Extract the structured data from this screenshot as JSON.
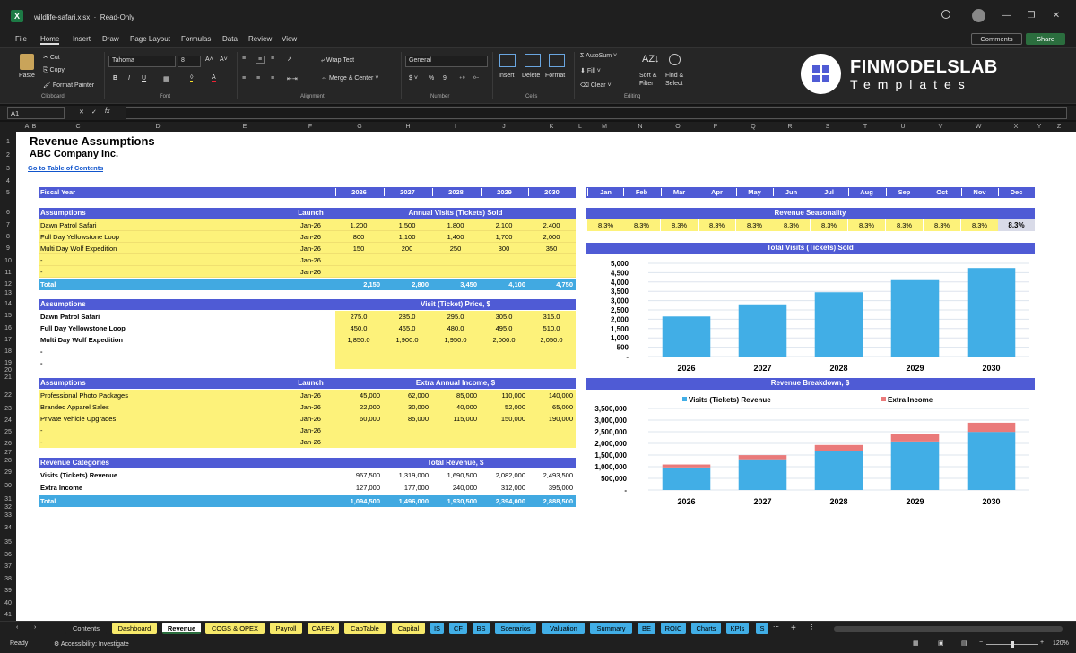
{
  "window": {
    "title": "wildlife-safari.xlsx",
    "mode": "Read-Only"
  },
  "menu": [
    "File",
    "Home",
    "Insert",
    "Draw",
    "Page Layout",
    "Formulas",
    "Data",
    "Review",
    "View"
  ],
  "menu_active": "Home",
  "comments_label": "Comments",
  "share_label": "Share",
  "ribbon": {
    "clipboard": {
      "paste": "Paste",
      "cut": "Cut",
      "copy": "Copy",
      "format_painter": "Format Painter",
      "group": "Clipboard"
    },
    "font": {
      "name": "Tahoma",
      "size": "8",
      "group": "Font",
      "bold": "B",
      "italic": "I",
      "underline": "U"
    },
    "alignment": {
      "wrap": "Wrap Text",
      "merge": "Merge & Center",
      "group": "Alignment"
    },
    "number": {
      "format": "General",
      "group": "Number",
      "currency": "$",
      "percent": "%",
      "comma": "9"
    },
    "cells": {
      "insert": "Insert",
      "delete": "Delete",
      "format": "Format",
      "group": "Cells"
    },
    "editing": {
      "autosum": "AutoSum",
      "fill": "Fill",
      "clear": "Clear",
      "sort": "Sort &\nFilter",
      "find": "Find &\nSelect",
      "group": "Editing"
    }
  },
  "brand": {
    "name": "FINMODELSLAB",
    "sub": "Templates"
  },
  "formula": {
    "namebox": "A1",
    "fx": "fx"
  },
  "columns": [
    "A",
    "B",
    "C",
    "D",
    "E",
    "F",
    "G",
    "H",
    "I",
    "J",
    "K",
    "L",
    "M",
    "N",
    "O",
    "P",
    "Q",
    "R",
    "S",
    "T",
    "U",
    "V",
    "W",
    "X",
    "Y",
    "Z"
  ],
  "sheet": {
    "title": "Revenue Assumptions",
    "company": "ABC Company Inc.",
    "toc_link": "Go to Table of Contents",
    "fiscal_year_label": "Fiscal Year",
    "years": [
      "2026",
      "2027",
      "2028",
      "2029",
      "2030"
    ],
    "months": [
      "Jan",
      "Feb",
      "Mar",
      "Apr",
      "May",
      "Jun",
      "Jul",
      "Aug",
      "Sep",
      "Oct",
      "Nov",
      "Dec"
    ],
    "assumptions_label": "Assumptions",
    "launch_label": "Launch",
    "visits": {
      "header": "Annual Visits (Tickets) Sold",
      "rows": [
        {
          "name": "Dawn Patrol Safari",
          "launch": "Jan-26",
          "values": [
            "1,200",
            "1,500",
            "1,800",
            "2,100",
            "2,400"
          ]
        },
        {
          "name": "Full Day Yellowstone Loop",
          "launch": "Jan-26",
          "values": [
            "800",
            "1,100",
            "1,400",
            "1,700",
            "2,000"
          ]
        },
        {
          "name": "Multi Day Wolf Expedition",
          "launch": "Jan-26",
          "values": [
            "150",
            "200",
            "250",
            "300",
            "350"
          ]
        },
        {
          "name": "-",
          "launch": "Jan-26",
          "values": [
            "",
            "",
            "",
            "",
            ""
          ]
        },
        {
          "name": "-",
          "launch": "Jan-26",
          "values": [
            "",
            "",
            "",
            "",
            ""
          ]
        }
      ],
      "total_label": "Total",
      "totals": [
        "2,150",
        "2,800",
        "3,450",
        "4,100",
        "4,750"
      ]
    },
    "price": {
      "header": "Visit (Ticket) Price, $",
      "rows": [
        {
          "name": "Dawn Patrol Safari",
          "values": [
            "275.0",
            "285.0",
            "295.0",
            "305.0",
            "315.0"
          ]
        },
        {
          "name": "Full Day Yellowstone Loop",
          "values": [
            "450.0",
            "465.0",
            "480.0",
            "495.0",
            "510.0"
          ]
        },
        {
          "name": "Multi Day Wolf Expedition",
          "values": [
            "1,850.0",
            "1,900.0",
            "1,950.0",
            "2,000.0",
            "2,050.0"
          ]
        },
        {
          "name": "-",
          "values": [
            "",
            "",
            "",
            "",
            ""
          ]
        },
        {
          "name": "-",
          "values": [
            "",
            "",
            "",
            "",
            ""
          ]
        }
      ]
    },
    "extra": {
      "header": "Extra Annual Income, $",
      "rows": [
        {
          "name": "Professional Photo Packages",
          "launch": "Jan-26",
          "values": [
            "45,000",
            "62,000",
            "85,000",
            "110,000",
            "140,000"
          ]
        },
        {
          "name": "Branded Apparel Sales",
          "launch": "Jan-26",
          "values": [
            "22,000",
            "30,000",
            "40,000",
            "52,000",
            "65,000"
          ]
        },
        {
          "name": "Private Vehicle Upgrades",
          "launch": "Jan-26",
          "values": [
            "60,000",
            "85,000",
            "115,000",
            "150,000",
            "190,000"
          ]
        },
        {
          "name": "-",
          "launch": "Jan-26",
          "values": [
            "",
            "",
            "",
            "",
            ""
          ]
        },
        {
          "name": "-",
          "launch": "Jan-26",
          "values": [
            "",
            "",
            "",
            "",
            ""
          ]
        }
      ]
    },
    "revenue": {
      "label": "Revenue Categories",
      "header": "Total Revenue, $",
      "rows": [
        {
          "name": "Visits (Tickets) Revenue",
          "values": [
            "967,500",
            "1,319,000",
            "1,690,500",
            "2,082,000",
            "2,493,500"
          ]
        },
        {
          "name": "Extra Income",
          "values": [
            "127,000",
            "177,000",
            "240,000",
            "312,000",
            "395,000"
          ]
        }
      ],
      "total_label": "Total",
      "totals": [
        "1,094,500",
        "1,496,000",
        "1,930,500",
        "2,394,000",
        "2,888,500"
      ]
    },
    "seasonality": {
      "header": "Revenue Seasonality",
      "values": [
        "8.3%",
        "8.3%",
        "8.3%",
        "8.3%",
        "8.3%",
        "8.3%",
        "8.3%",
        "8.3%",
        "8.3%",
        "8.3%",
        "8.3%",
        "8.3%"
      ]
    }
  },
  "row_numbers": [
    "1",
    "2",
    "3",
    "4",
    "5",
    "6",
    "7",
    "8",
    "9",
    "10",
    "11",
    "12",
    "13",
    "14",
    "15",
    "16",
    "17",
    "18",
    "19",
    "20",
    "21",
    "22",
    "23",
    "24",
    "25",
    "26",
    "27",
    "28",
    "29",
    "30",
    "31",
    "32",
    "33",
    "34",
    "35",
    "36",
    "37",
    "38",
    "39",
    "40",
    "41",
    "42"
  ],
  "chart_data": [
    {
      "type": "bar",
      "title": "Total Visits (Tickets) Sold",
      "categories": [
        "2026",
        "2027",
        "2028",
        "2029",
        "2030"
      ],
      "values": [
        2150,
        2800,
        3450,
        4100,
        4750
      ],
      "yticks": [
        "5,000",
        "4,500",
        "4,000",
        "3,500",
        "3,000",
        "2,500",
        "2,000",
        "1,500",
        "1,000",
        "500",
        "-"
      ],
      "ylim": [
        0,
        5000
      ],
      "color": "#41aee6",
      "grid": true
    },
    {
      "type": "bar",
      "title": "Revenue Breakdown, $",
      "categories": [
        "2026",
        "2027",
        "2028",
        "2029",
        "2030"
      ],
      "series": [
        {
          "name": "Visits (Tickets) Revenue",
          "values": [
            967500,
            1319000,
            1690500,
            2082000,
            2493500
          ],
          "color": "#41aee6"
        },
        {
          "name": "Extra Income",
          "values": [
            127000,
            177000,
            240000,
            312000,
            395000
          ],
          "color": "#ea7a7a"
        }
      ],
      "yticks": [
        "3,500,000",
        "3,000,000",
        "2,500,000",
        "2,000,000",
        "1,500,000",
        "1,000,000",
        "500,000",
        "-"
      ],
      "ylim": [
        0,
        3500000
      ],
      "stacked": true,
      "legend": "top",
      "grid": true
    }
  ],
  "tabs": [
    {
      "label": "Contents",
      "color": "#1f1f1f",
      "text": "#ddd"
    },
    {
      "label": "Dashboard",
      "color": "#f7e96a",
      "text": "#000"
    },
    {
      "label": "Revenue",
      "color": "#ffffff",
      "text": "#000",
      "active": true
    },
    {
      "label": "COGS & OPEX",
      "color": "#f7e96a",
      "text": "#000"
    },
    {
      "label": "Payroll",
      "color": "#f7e96a",
      "text": "#000"
    },
    {
      "label": "CAPEX",
      "color": "#f7e96a",
      "text": "#000"
    },
    {
      "label": "CapTable",
      "color": "#f7e96a",
      "text": "#000"
    },
    {
      "label": "Capital",
      "color": "#f7e96a",
      "text": "#000"
    },
    {
      "label": "IS",
      "color": "#41aee6",
      "text": "#000"
    },
    {
      "label": "CF",
      "color": "#41aee6",
      "text": "#000"
    },
    {
      "label": "BS",
      "color": "#41aee6",
      "text": "#000"
    },
    {
      "label": "Scenarios",
      "color": "#41aee6",
      "text": "#000"
    },
    {
      "label": "Valuation",
      "color": "#41aee6",
      "text": "#000"
    },
    {
      "label": "Summary",
      "color": "#41aee6",
      "text": "#000"
    },
    {
      "label": "BE",
      "color": "#41aee6",
      "text": "#000"
    },
    {
      "label": "ROIC",
      "color": "#41aee6",
      "text": "#000"
    },
    {
      "label": "Charts",
      "color": "#41aee6",
      "text": "#000"
    },
    {
      "label": "KPIs",
      "color": "#41aee6",
      "text": "#000"
    },
    {
      "label": "S",
      "color": "#41aee6",
      "text": "#000"
    }
  ],
  "status": {
    "ready": "Ready",
    "accessibility": "Accessibility: Investigate",
    "zoom": "120%"
  }
}
